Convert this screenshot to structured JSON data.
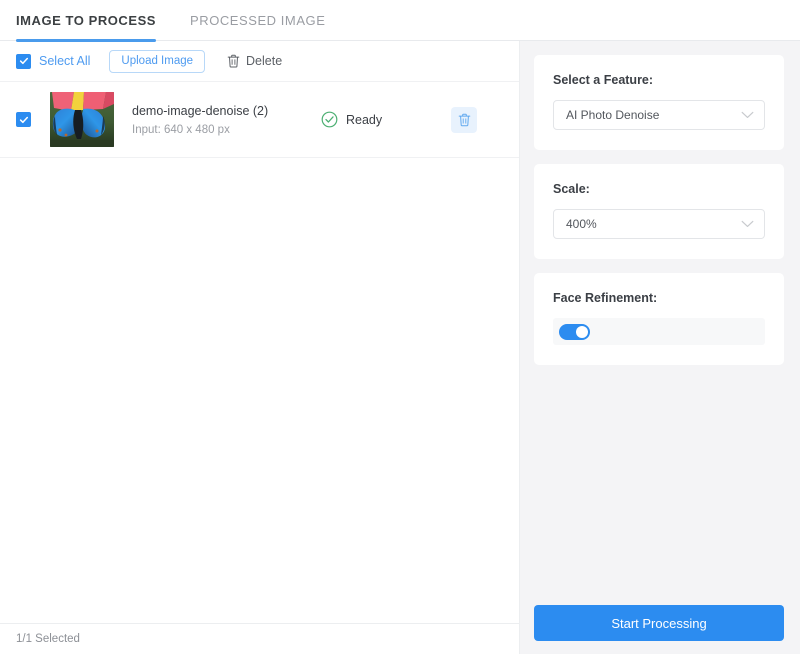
{
  "tabs": [
    {
      "label": "IMAGE TO PROCESS",
      "active": true
    },
    {
      "label": "PROCESSED IMAGE",
      "active": false
    }
  ],
  "toolbar": {
    "select_all_label": "Select All",
    "upload_label": "Upload Image",
    "delete_label": "Delete",
    "select_all_checked": true
  },
  "files": [
    {
      "name": "demo-image-denoise (2)",
      "input_info": "Input: 640 x 480 px",
      "status": "Ready",
      "checked": true,
      "thumbnail": "butterfly-photo"
    }
  ],
  "statusbar": {
    "selected_count": "1/1 Selected"
  },
  "panel": {
    "feature": {
      "label": "Select a Feature:",
      "value": "AI Photo Denoise"
    },
    "scale": {
      "label": "Scale:",
      "value": "400%"
    },
    "face_refinement": {
      "label": "Face Refinement:",
      "enabled": true
    },
    "start_button": "Start Processing"
  },
  "colors": {
    "accent": "#2c8cf0",
    "tab_active_underline": "#4a9bec",
    "link_blue": "#4e9bf0",
    "status_green": "#4caf72",
    "panel_bg": "#f4f4f6"
  },
  "icons": {
    "check": "check-icon",
    "trash": "trash-icon",
    "chevron": "chevron-down-icon",
    "ready": "check-circle-icon"
  }
}
